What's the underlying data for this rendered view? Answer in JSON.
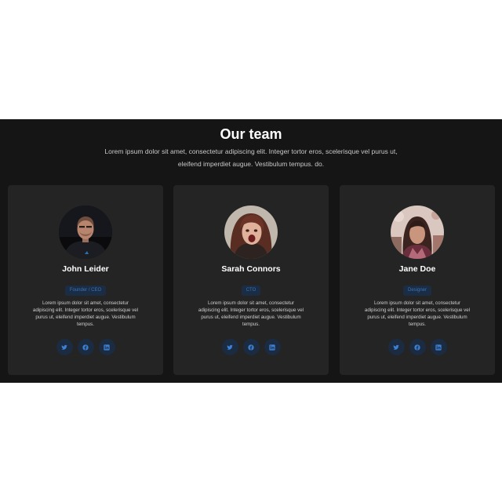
{
  "section": {
    "title": "Our team",
    "subtitle": "Lorem ipsum dolor sit amet, consectetur adipiscing elit. Integer tortor eros, scelerisque vel purus ut, eleifend imperdiet augue. Vestibulum tempus. do."
  },
  "colors": {
    "section_background": "#151515",
    "card_background": "#242424",
    "badge_background": "#1b2d44",
    "badge_text": "#3a73b8",
    "social_button_background": "#1b2b41",
    "social_icon": "#3d7fd0"
  },
  "members": [
    {
      "name": "John Leider",
      "role": "Founder / CEO",
      "bio": "Lorem ipsum dolor sit amet, consectetur adipiscing elit. Integer tortor eros, scelerisque vel purus ut, eleifend imperdiet augue. Vestibulum tempus.",
      "socials": [
        "twitter-icon",
        "facebook-icon",
        "linkedin-icon"
      ]
    },
    {
      "name": "Sarah Connors",
      "role": "CTO",
      "bio": "Lorem ipsum dolor sit amet, consectetur adipiscing elit. Integer tortor eros, scelerisque vel purus ut, eleifend imperdiet augue. Vestibulum tempus.",
      "socials": [
        "twitter-icon",
        "facebook-icon",
        "linkedin-icon"
      ]
    },
    {
      "name": "Jane Doe",
      "role": "Designer",
      "bio": "Lorem ipsum dolor sit amet, consectetur adipiscing elit. Integer tortor eros, scelerisque vel purus ut, eleifend imperdiet augue. Vestibulum tempus.",
      "socials": [
        "twitter-icon",
        "facebook-icon",
        "linkedin-icon"
      ]
    }
  ]
}
